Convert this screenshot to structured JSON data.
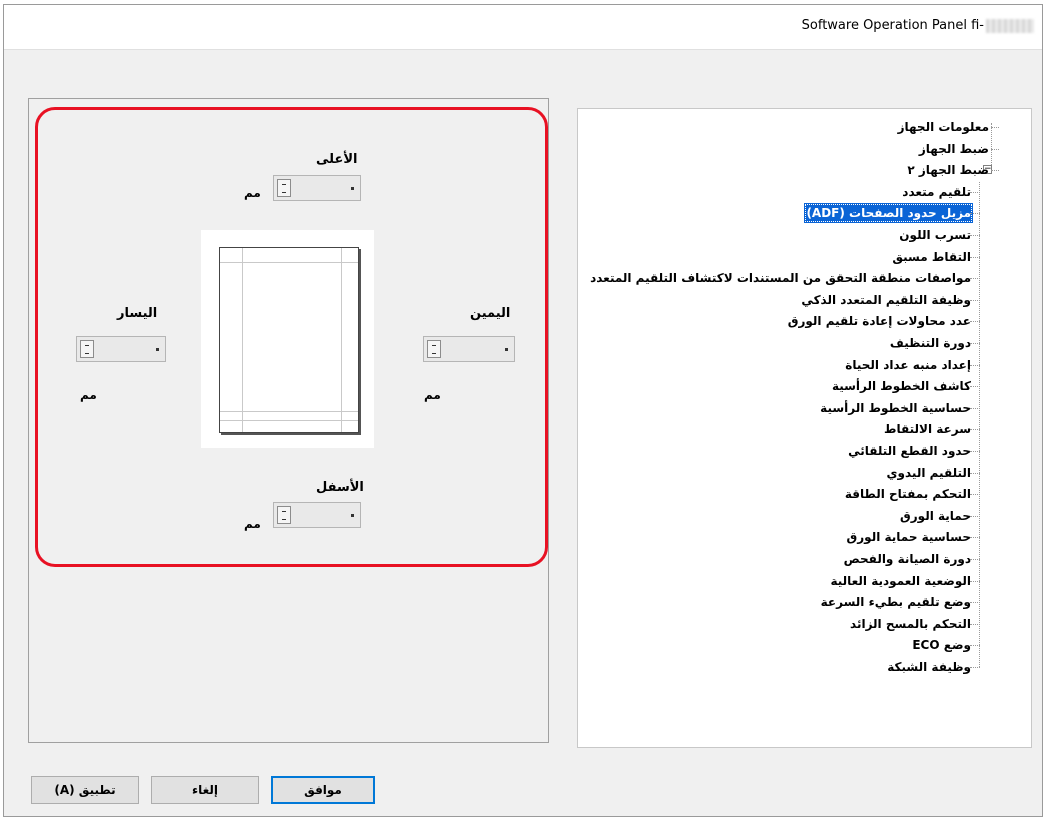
{
  "window": {
    "title": "Software Operation Panel fi-"
  },
  "margins": {
    "top": {
      "label": "الأعلى",
      "unit": "مم"
    },
    "bottom": {
      "label": "الأسفل",
      "unit": "مم"
    },
    "left": {
      "label": "اليسار",
      "unit": "مم"
    },
    "right": {
      "label": "اليمين",
      "unit": "مم"
    }
  },
  "tree": {
    "items": [
      {
        "label": "معلومات الجهاز",
        "level": 0
      },
      {
        "label": "ضبط الجهاز",
        "level": 0
      },
      {
        "label": "ضبط الجهاز ٢",
        "level": 0,
        "expanded": true
      },
      {
        "label": "تلقيم متعدد",
        "level": 1
      },
      {
        "label": "مزيل حدود الصفحات (ADF)",
        "level": 1,
        "selected": true
      },
      {
        "label": "تسرب اللون",
        "level": 1
      },
      {
        "label": "التقاط مسبق",
        "level": 1
      },
      {
        "label": "مواصفات منطقة التحقق من المستندات لاكتشاف التلقيم المتعدد",
        "level": 1
      },
      {
        "label": "وظيفة التلقيم المتعدد الذكي",
        "level": 1
      },
      {
        "label": "عدد محاولات إعادة تلقيم الورق",
        "level": 1
      },
      {
        "label": "دورة التنظيف",
        "level": 1
      },
      {
        "label": "إعداد منبه عداد الحياة",
        "level": 1
      },
      {
        "label": "كاشف الخطوط الرأسية",
        "level": 1
      },
      {
        "label": "حساسية الخطوط الرأسية",
        "level": 1
      },
      {
        "label": "سرعة الالتقاط",
        "level": 1
      },
      {
        "label": "حدود القطع التلقائي",
        "level": 1
      },
      {
        "label": "التلقيم اليدوي",
        "level": 1
      },
      {
        "label": "التحكم بمفتاح الطاقة",
        "level": 1
      },
      {
        "label": "حماية الورق",
        "level": 1
      },
      {
        "label": "حساسية حماية الورق",
        "level": 1
      },
      {
        "label": "دورة الصيانة والفحص",
        "level": 1
      },
      {
        "label": "الوضعية العمودية العالية",
        "level": 1
      },
      {
        "label": "وضع تلقيم بطيء السرعة",
        "level": 1
      },
      {
        "label": "التحكم بالمسح الزائد",
        "level": 1
      },
      {
        "label": "وضع ECO",
        "level": 1
      },
      {
        "label": "وظيفة الشبكة",
        "level": 1
      }
    ]
  },
  "buttons": {
    "ok": "موافق",
    "cancel": "إلغاء",
    "apply": "تطبيق (A)"
  },
  "colors": {
    "highlight": "#e81123",
    "selection": "#0a64d6"
  }
}
